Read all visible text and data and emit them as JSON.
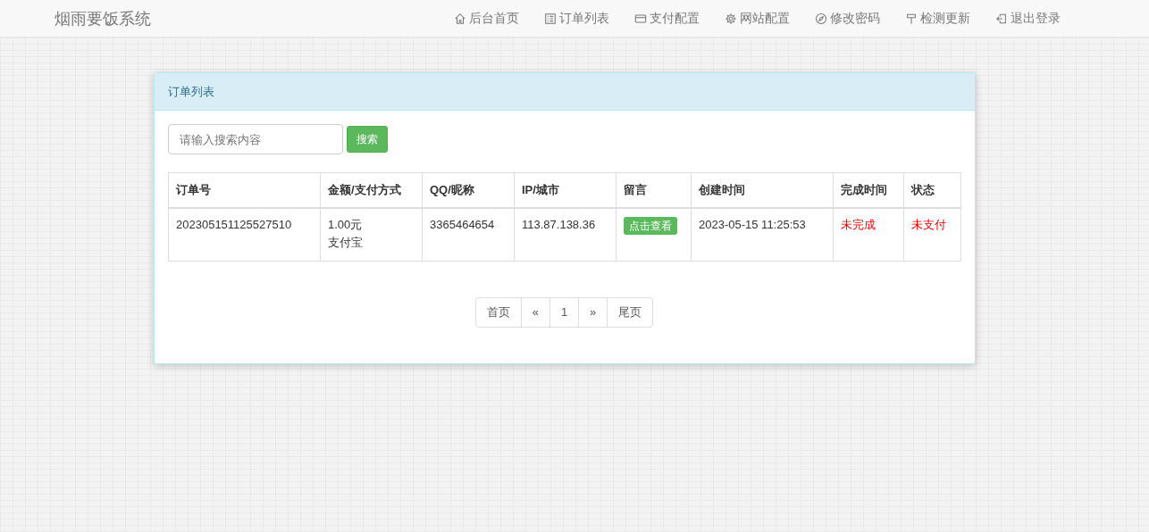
{
  "brand": "烟雨要饭系统",
  "nav": [
    {
      "label": "后台首页"
    },
    {
      "label": "订单列表"
    },
    {
      "label": "支付配置"
    },
    {
      "label": "网站配置"
    },
    {
      "label": "修改密码"
    },
    {
      "label": "检测更新"
    },
    {
      "label": "退出登录"
    }
  ],
  "panel": {
    "title": "订单列表"
  },
  "search": {
    "placeholder": "请输入搜索内容",
    "button": "搜索"
  },
  "table": {
    "columns": [
      "订单号",
      "金额/支付方式",
      "QQ/昵称",
      "IP/城市",
      "留言",
      "创建时间",
      "完成时间",
      "状态"
    ],
    "rows": [
      {
        "cells": [
          {
            "kind": "text",
            "lines": [
              "202305151125527510"
            ]
          },
          {
            "kind": "text",
            "lines": [
              "1.00元",
              "支付宝"
            ]
          },
          {
            "kind": "text",
            "lines": [
              "3365464654"
            ]
          },
          {
            "kind": "text",
            "lines": [
              "113.87.138.36"
            ]
          },
          {
            "kind": "button",
            "lines": [
              "点击查看"
            ]
          },
          {
            "kind": "text",
            "lines": [
              "2023-05-15 11:25:53"
            ]
          },
          {
            "kind": "alert",
            "lines": [
              "未完成"
            ]
          },
          {
            "kind": "alert",
            "lines": [
              "未支付"
            ]
          }
        ]
      }
    ]
  },
  "pagination": [
    "首页",
    "«",
    "1",
    "»",
    "尾页"
  ]
}
